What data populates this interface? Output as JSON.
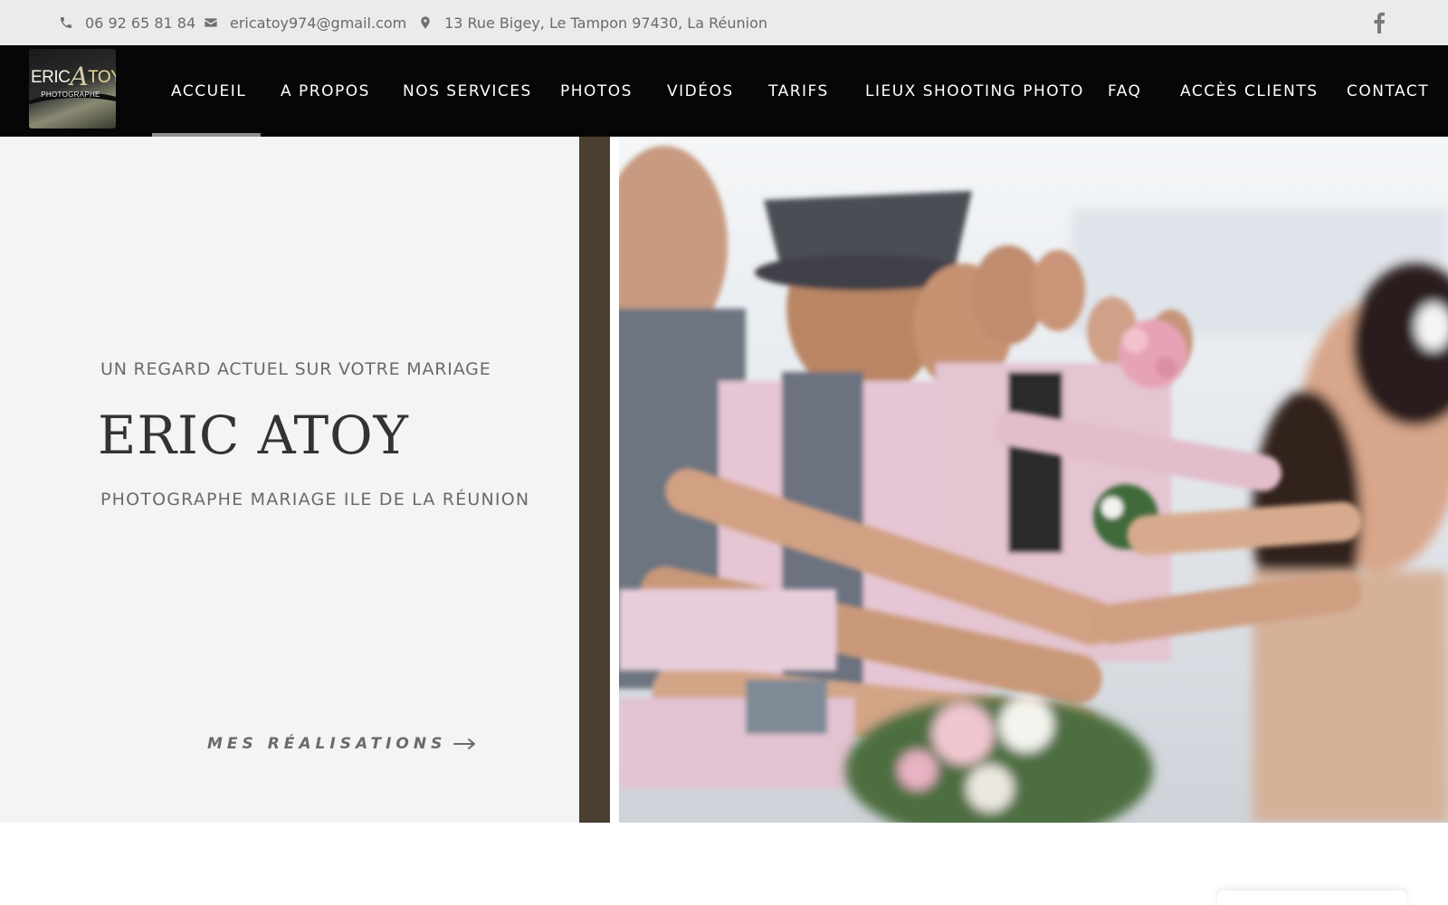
{
  "topbar": {
    "phone": "06 92 65 81 84",
    "email": "ericatoy974@gmail.com",
    "address": "13 Rue Bigey, Le Tampon 97430, La Réunion",
    "social_icon": "facebook-icon"
  },
  "logo": {
    "name_part1": "ERIC",
    "name_part2": "A",
    "name_part3": "TOY",
    "tagline": "PHOTOGRAPHE"
  },
  "nav": {
    "active": "ACCUEIL",
    "items": [
      {
        "label": "ACCUEIL"
      },
      {
        "label": "A PROPOS"
      },
      {
        "label": "NOS SERVICES"
      },
      {
        "label": "PHOTOS"
      },
      {
        "label": "VIDÉOS"
      },
      {
        "label": "TARIFS"
      },
      {
        "label": "LIEUX SHOOTING PHOTO"
      },
      {
        "label": "FAQ"
      },
      {
        "label": "ACCÈS CLIENTS"
      },
      {
        "label": "CONTACT"
      }
    ]
  },
  "hero": {
    "tagline": "UN REGARD ACTUEL SUR VOTRE MARIAGE",
    "title": "ERIC ATOY",
    "subtitle": "PHOTOGRAPHE MARIAGE ILE DE LA RÉUNION",
    "cta_label": "MES RÉALISATIONS",
    "cta_icon": "arrow-right-icon",
    "photo_icon": "wedding-photo"
  },
  "colors": {
    "topbar_bg": "#e9ebec",
    "nav_bg": "#060606",
    "hero_left_bg": "#f4f4f4",
    "accent_bar": "#4a3f30",
    "text_gray": "#6a6a6a",
    "title_dark": "#333333"
  }
}
